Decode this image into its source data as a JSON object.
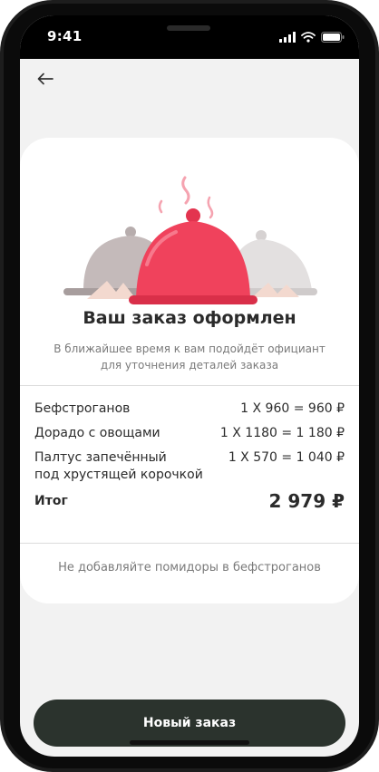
{
  "status_bar": {
    "time": "9:41",
    "icons": [
      "cellular-signal-icon",
      "wifi-icon",
      "battery-icon"
    ]
  },
  "nav": {
    "back_icon": "arrow-left-icon"
  },
  "order": {
    "illustration": "serving-cloches-illustration",
    "title": "Ваш заказ оформлен",
    "subtitle": "В ближайшее время к вам подойдёт официант для уточнения деталей заказа",
    "items": [
      {
        "name": "Бефстроганов",
        "price": "1 Х 960 = 960 ₽"
      },
      {
        "name": "Дорадо с овощами",
        "price": "1 Х 1180 = 1 180 ₽"
      },
      {
        "name": "Палтус запечённый\nпод хрустящей корочкой",
        "price": "1 Х 570 = 1 040 ₽"
      }
    ],
    "total_label": "Итог",
    "total_value": "2 979 ₽",
    "comment": "Не добавляйте помидоры в бефстроганов"
  },
  "actions": {
    "new_order": "Новый заказ"
  },
  "colors": {
    "accent_red": "#f0425c",
    "button_dark": "#2b332d",
    "background": "#f2f2f2",
    "card": "#ffffff"
  }
}
